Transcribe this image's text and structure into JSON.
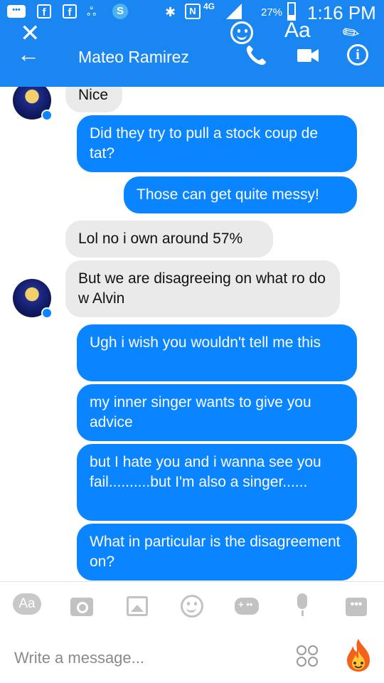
{
  "status_bar": {
    "network": "4G",
    "battery_pct": "27%",
    "battery_level": 0.27,
    "time": "1:16 PM"
  },
  "overlay": {
    "text_tool": "Aa"
  },
  "header": {
    "contact_name": "Mateo Ramirez"
  },
  "messages": [
    {
      "from": "them",
      "text": "Nice"
    },
    {
      "from": "me",
      "text": "Did they try to pull a stock coup de tat?"
    },
    {
      "from": "me",
      "text": "Those can get quite messy!"
    },
    {
      "from": "them",
      "text": "Lol no i own around 57%"
    },
    {
      "from": "them",
      "text": "But we are disagreeing on what ro do w Alvin"
    },
    {
      "from": "me",
      "text": "Ugh i wish you wouldn't tell me this"
    },
    {
      "from": "me",
      "text": "my inner singer wants to give you advice"
    },
    {
      "from": "me",
      "text": "but I hate you and i wanna see you fail..........but I'm also a singer......"
    },
    {
      "from": "me",
      "text": "What in particular is the disagreement on?"
    }
  ],
  "toolbar": {
    "aa_label": "Aa",
    "more_label": "•••",
    "icons": [
      "text-style-icon",
      "camera-icon",
      "image-icon",
      "emoji-icon",
      "game-icon",
      "microphone-icon",
      "more-icon"
    ]
  },
  "composer": {
    "placeholder": "Write a message..."
  },
  "colors": {
    "brand_blue": "#1a86f2",
    "sent_bubble": "#0a84ff",
    "received_bubble": "#eaeaea"
  }
}
